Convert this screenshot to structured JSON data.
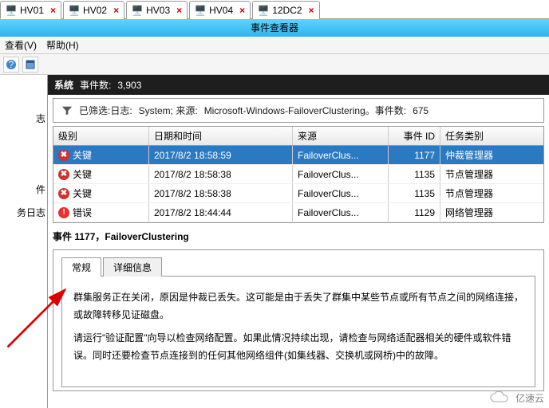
{
  "tabs": {
    "t1": "HV01",
    "t2": "HV02",
    "t3": "HV03",
    "t4": "HV04",
    "t5": "12DC2"
  },
  "window": {
    "title": "事件查看器"
  },
  "menu": {
    "view": "查看(V)",
    "help": "帮助(H)"
  },
  "sidebar": {
    "s1": "志",
    "s2": "件",
    "s3": "务日志"
  },
  "header": {
    "system": "系统",
    "eventcount_label": "事件数:",
    "eventcount_value": "3,903"
  },
  "filter": {
    "label": "已筛选:日志:",
    "log": "System; 来源:",
    "source": "Microsoft-Windows-FailoverClustering。事件数:",
    "count": "675"
  },
  "columns": {
    "level": "级别",
    "date": "日期和时间",
    "source": "来源",
    "id": "事件 ID",
    "category": "任务类别"
  },
  "rows": {
    "r0": {
      "level": "关键",
      "date": "2017/8/2 18:58:59",
      "source": "FailoverClus...",
      "id": "1177",
      "cat": "仲裁管理器"
    },
    "r1": {
      "level": "关键",
      "date": "2017/8/2 18:58:38",
      "source": "FailoverClus...",
      "id": "1135",
      "cat": "节点管理器"
    },
    "r2": {
      "level": "关键",
      "date": "2017/8/2 18:58:38",
      "source": "FailoverClus...",
      "id": "1135",
      "cat": "节点管理器"
    },
    "r3": {
      "level": "错误",
      "date": "2017/8/2 18:44:44",
      "source": "FailoverClus...",
      "id": "1129",
      "cat": "网络管理器"
    }
  },
  "detail": {
    "title": "事件 1177，FailoverClustering",
    "tab_general": "常规",
    "tab_detail": "详细信息",
    "body_l1": "群集服务正在关闭，原因是仲裁已丢失。这可能是由于丢失了群集中某些节点或所有节点之间的网络连接，或故障转移见证磁盘。",
    "body_l2": "请运行\"验证配置\"向导以检查网络配置。如果此情况持续出现，请检查与网络适配器相关的硬件或软件错误。同时还要检查节点连接到的任何其他网络组件(如集线器、交换机或网桥)中的故障。"
  },
  "watermark": {
    "text": "亿速云"
  }
}
